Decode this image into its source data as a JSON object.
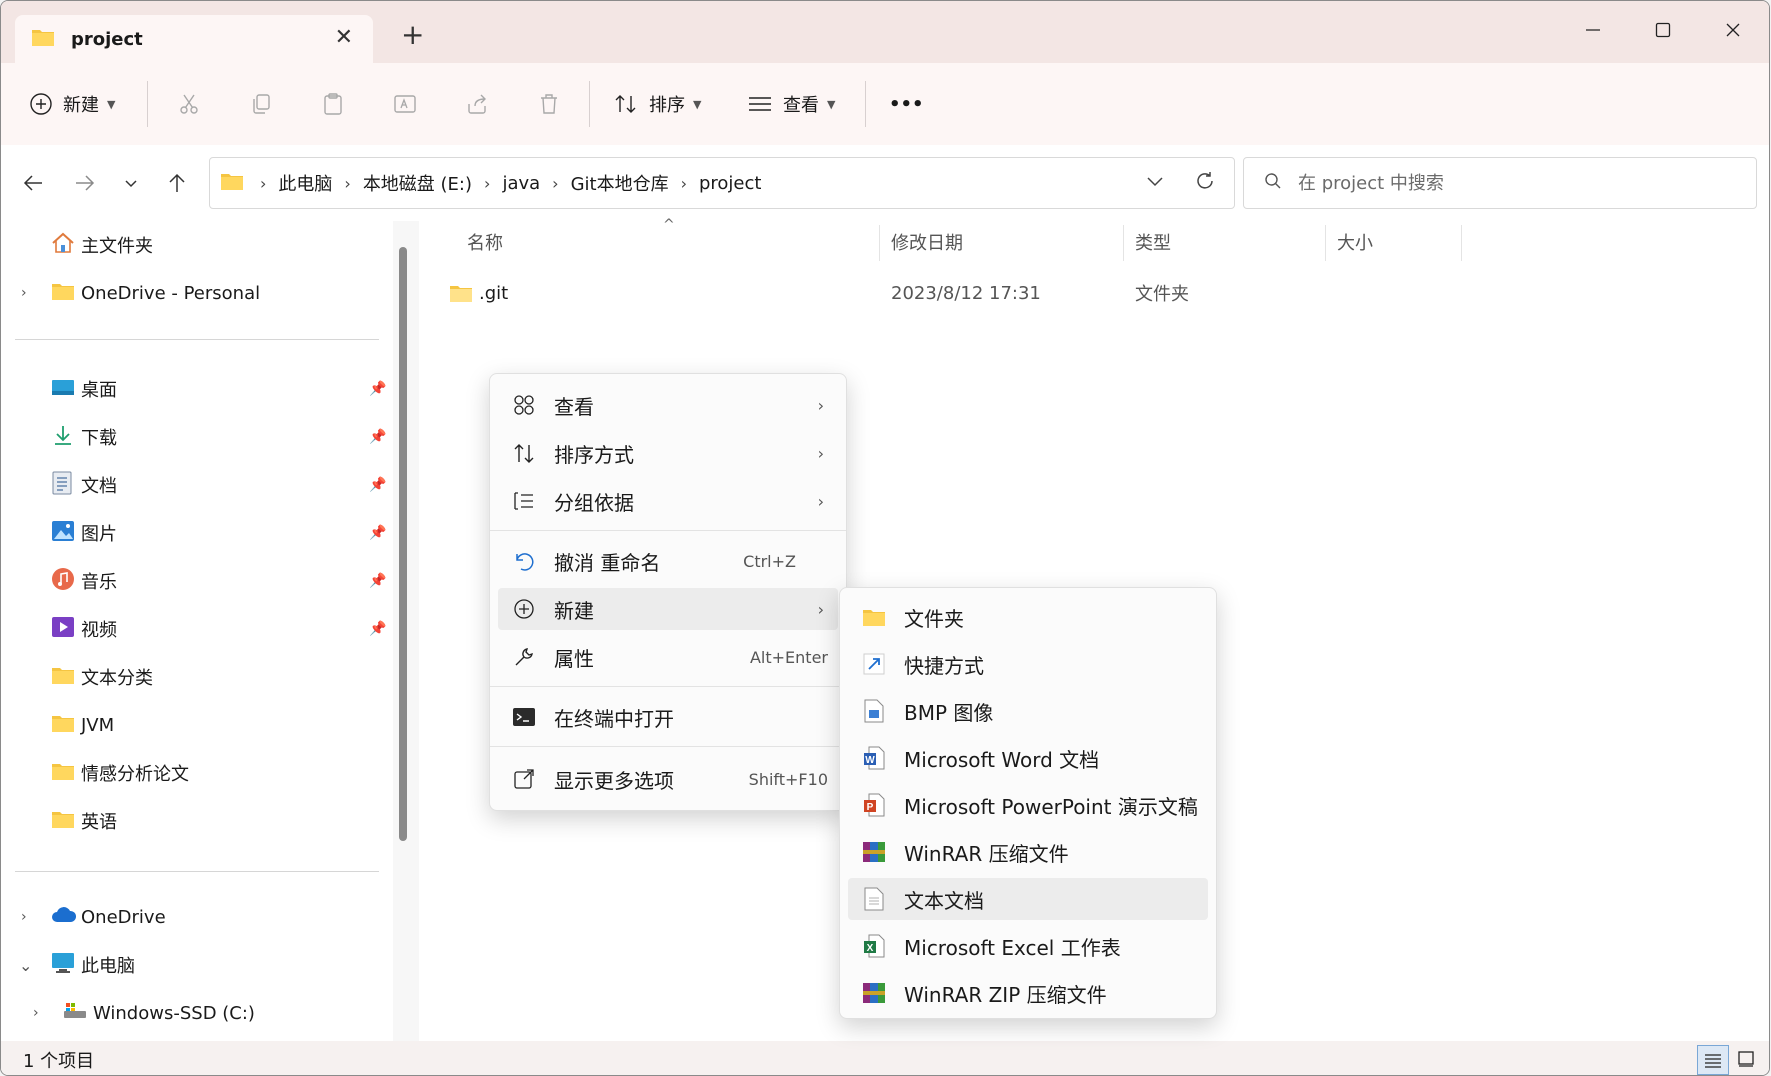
{
  "window": {
    "tab_title": "project",
    "tab_close": "✕",
    "new_tab": "+"
  },
  "toolbar": {
    "new_label": "新建",
    "sort_label": "排序",
    "view_label": "查看",
    "more": "•••"
  },
  "address": {
    "crumbs": [
      "此电脑",
      "本地磁盘 (E:)",
      "java",
      "Git本地仓库",
      "project"
    ],
    "separator": "›"
  },
  "search": {
    "placeholder": "在 project 中搜索"
  },
  "sidebar": {
    "items": [
      {
        "label": "主文件夹",
        "icon": "home-icon"
      },
      {
        "label": "OneDrive - Personal",
        "icon": "folder-icon"
      },
      {
        "label": "桌面",
        "icon": "desktop-icon"
      },
      {
        "label": "下载",
        "icon": "download-icon"
      },
      {
        "label": "文档",
        "icon": "document-icon"
      },
      {
        "label": "图片",
        "icon": "pictures-icon"
      },
      {
        "label": "音乐",
        "icon": "music-icon"
      },
      {
        "label": "视频",
        "icon": "video-icon"
      },
      {
        "label": "文本分类",
        "icon": "folder-icon"
      },
      {
        "label": "JVM",
        "icon": "folder-icon"
      },
      {
        "label": "情感分析论文",
        "icon": "folder-icon"
      },
      {
        "label": "英语",
        "icon": "folder-icon"
      },
      {
        "label": "OneDrive",
        "icon": "cloud-icon"
      },
      {
        "label": "此电脑",
        "icon": "computer-icon"
      },
      {
        "label": "Windows-SSD (C:)",
        "icon": "drive-icon"
      }
    ]
  },
  "filelist": {
    "columns": [
      "名称",
      "修改日期",
      "类型",
      "大小"
    ],
    "rows": [
      {
        "name": ".git",
        "modified": "2023/8/12 17:31",
        "type": "文件夹",
        "size": ""
      }
    ]
  },
  "context_menu": {
    "items": [
      {
        "label": "查看",
        "icon": "grid-view-icon"
      },
      {
        "label": "排序方式",
        "icon": "sort-icon"
      },
      {
        "label": "分组依据",
        "icon": "group-icon"
      },
      {
        "label": "撤消 重命名",
        "shortcut": "Ctrl+Z",
        "icon": "undo-icon"
      },
      {
        "label": "新建",
        "icon": "new-icon"
      },
      {
        "label": "属性",
        "shortcut": "Alt+Enter",
        "icon": "wrench-icon"
      },
      {
        "label": "在终端中打开",
        "icon": "terminal-icon"
      },
      {
        "label": "显示更多选项",
        "shortcut": "Shift+F10",
        "icon": "more-options-icon"
      }
    ]
  },
  "submenu": {
    "items": [
      {
        "label": "文件夹",
        "icon": "folder-icon"
      },
      {
        "label": "快捷方式",
        "icon": "shortcut-icon"
      },
      {
        "label": "BMP 图像",
        "icon": "bmp-icon"
      },
      {
        "label": "Microsoft Word 文档",
        "icon": "word-icon"
      },
      {
        "label": "Microsoft PowerPoint 演示文稿",
        "icon": "powerpoint-icon"
      },
      {
        "label": "WinRAR 压缩文件",
        "icon": "winrar-icon"
      },
      {
        "label": "文本文档",
        "icon": "text-document-icon"
      },
      {
        "label": "Microsoft Excel 工作表",
        "icon": "excel-icon"
      },
      {
        "label": "WinRAR ZIP 压缩文件",
        "icon": "winrar-zip-icon"
      }
    ]
  },
  "status": {
    "text": "1 个项目"
  },
  "colors": {
    "folder": "#f5c542",
    "titlebar": "#f3e6e4",
    "toolbar": "#fdf6f5",
    "accent": "#0067c0"
  }
}
